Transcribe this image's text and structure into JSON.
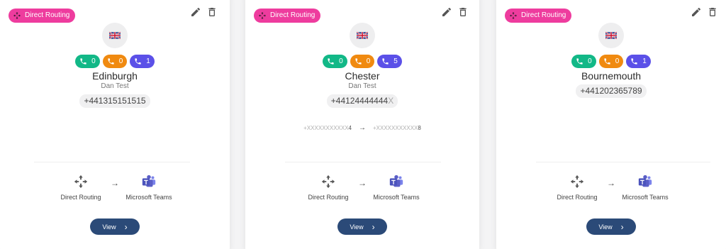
{
  "cards": [
    {
      "badge": "Direct Routing",
      "site": "Edinburgh",
      "owner": "Dan Test",
      "number": "+441315151515",
      "number_suffix": "",
      "calls": [
        "0",
        "0",
        "1"
      ],
      "mask_from": "",
      "mask_from_end": "",
      "mask_to": "",
      "mask_to_end": "",
      "flow_from": "Direct Routing",
      "flow_to": "Microsoft Teams",
      "view_label": "View"
    },
    {
      "badge": "Direct Routing",
      "site": "Chester",
      "owner": "Dan Test",
      "number": "+44124444444",
      "number_suffix": "X",
      "calls": [
        "0",
        "0",
        "5"
      ],
      "mask_from": "+XXXXXXXXXXX",
      "mask_from_end": "4",
      "mask_to": "+XXXXXXXXXXX",
      "mask_to_end": "8",
      "flow_from": "Direct Routing",
      "flow_to": "Microsoft Teams",
      "view_label": "View"
    },
    {
      "badge": "Direct Routing",
      "site": "Bournemouth",
      "owner": "",
      "number": "+441202365789",
      "number_suffix": "",
      "calls": [
        "0",
        "0",
        "1"
      ],
      "mask_from": "",
      "mask_from_end": "",
      "mask_to": "",
      "mask_to_end": "",
      "flow_from": "Direct Routing",
      "flow_to": "Microsoft Teams",
      "view_label": "View"
    }
  ],
  "icons": {
    "badge": "direct-routing-icon",
    "edit": "pencil-icon",
    "delete": "trash-icon",
    "flag": "uk-flag-icon",
    "call": "phone-icon",
    "flow_from": "direct-routing-icon",
    "flow_to": "microsoft-teams-icon",
    "view": "chevron-right-icon"
  },
  "colors": {
    "badge": "#ee3c9e",
    "call_green": "#12b887",
    "call_orange": "#f08a10",
    "call_purple": "#5b50e8",
    "view_button": "#2b4a78",
    "teams": "#5b5fc7"
  }
}
